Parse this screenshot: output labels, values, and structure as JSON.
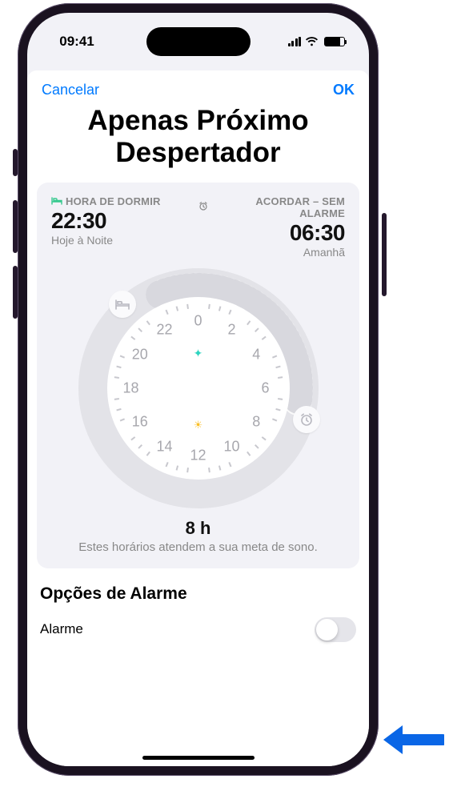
{
  "status": {
    "time": "09:41"
  },
  "header": {
    "cancel": "Cancelar",
    "ok": "OK"
  },
  "title": "Apenas Próximo Despertador",
  "sleep": {
    "bed_label": "HORA DE DORMIR",
    "bed_time": "22:30",
    "bed_sub": "Hoje à Noite",
    "wake_label": "ACORDAR – SEM ALARME",
    "wake_time": "06:30",
    "wake_sub": "Amanhã"
  },
  "dial": {
    "hours": [
      "0",
      "2",
      "4",
      "6",
      "8",
      "10",
      "12",
      "14",
      "16",
      "18",
      "20",
      "22"
    ]
  },
  "summary": {
    "duration": "8 h",
    "note": "Estes horários atendem a sua meta de sono."
  },
  "options": {
    "title": "Opções de Alarme",
    "alarm_label": "Alarme",
    "alarm_on": false
  },
  "colors": {
    "accent": "#007aff"
  }
}
